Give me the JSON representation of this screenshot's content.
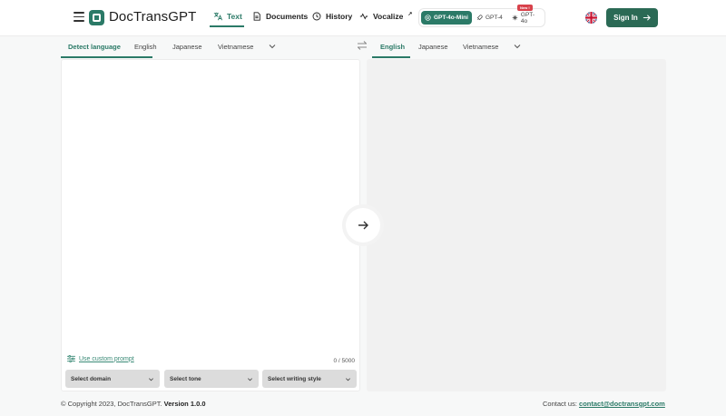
{
  "header": {
    "brand": "DocTransGPT",
    "nav": [
      {
        "label": "Text",
        "icon": "translate-icon"
      },
      {
        "label": "Documents",
        "icon": "document-icon"
      },
      {
        "label": "History",
        "icon": "clock-icon"
      },
      {
        "label": "Vocalize",
        "icon": "waveform-icon",
        "sup": "↗"
      }
    ],
    "models": [
      {
        "label": "GPT-4o-Mini",
        "icon": "openai-icon",
        "selected": true
      },
      {
        "label": "GPT-4",
        "icon": "rocket-icon"
      },
      {
        "label": "GPT-4o",
        "icon": "sparkle-icon",
        "badge": "New !"
      }
    ],
    "language_flag": "uk-flag-icon",
    "signin_label": "Sign In"
  },
  "source_langs": {
    "tabs": [
      "Detect language",
      "English",
      "Japanese",
      "Vietnamese"
    ],
    "active_index": 0
  },
  "target_langs": {
    "tabs": [
      "English",
      "Japanese",
      "Vietnamese"
    ],
    "active_index": 0
  },
  "source": {
    "custom_prompt": "Use custom prompt",
    "char_count": "0 / 5000",
    "selects": [
      "Select domain",
      "Select tone",
      "Select writing style"
    ]
  },
  "footer": {
    "copyright": "© Copyright 2023, DocTransGPT.",
    "version": "Version 1.0.0",
    "contact_label": "Contact us:",
    "contact_email": "contact@doctransgpt.com"
  },
  "colors": {
    "accent": "#2b7a67",
    "signin_bg": "#2b6a55",
    "badge": "#d8414b"
  }
}
